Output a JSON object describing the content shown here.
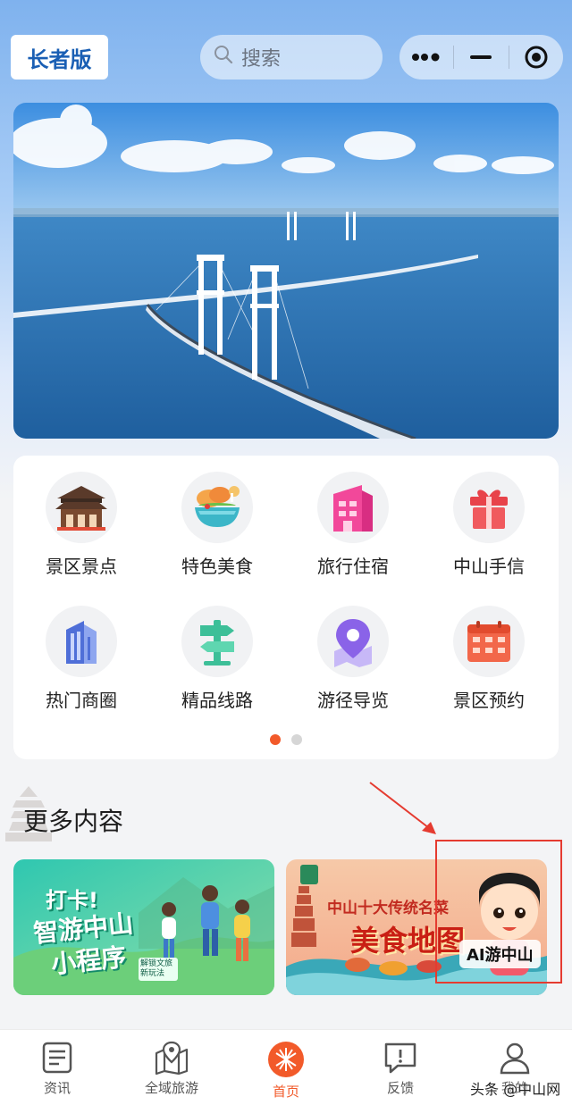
{
  "header": {
    "elder_mode": "长者版",
    "search_placeholder": "搜索"
  },
  "grid": {
    "items": [
      {
        "label": "景区景点",
        "icon": "pavilion-icon"
      },
      {
        "label": "特色美食",
        "icon": "food-bowl-icon"
      },
      {
        "label": "旅行住宿",
        "icon": "hotel-building-icon"
      },
      {
        "label": "中山手信",
        "icon": "gift-icon"
      },
      {
        "label": "热门商圈",
        "icon": "office-building-icon"
      },
      {
        "label": "精品线路",
        "icon": "signpost-icon"
      },
      {
        "label": "游径导览",
        "icon": "map-pin-icon"
      },
      {
        "label": "景区预约",
        "icon": "calendar-icon"
      }
    ],
    "page_count": 2,
    "active_page": 1
  },
  "section": {
    "title": "更多内容"
  },
  "promos": {
    "left": {
      "line1": "打卡!",
      "line2": "智游中山",
      "line3": "小程序",
      "badge": "解锁文旅新玩法"
    },
    "right": {
      "subtitle": "中山十大传统名菜",
      "title": "美食地图",
      "ai_label": "AI游中山"
    }
  },
  "tabbar": {
    "items": [
      {
        "label": "资讯",
        "icon": "news-icon"
      },
      {
        "label": "全域旅游",
        "icon": "map-location-icon"
      },
      {
        "label": "首页",
        "icon": "home-logo-icon"
      },
      {
        "label": "反馈",
        "icon": "feedback-icon"
      },
      {
        "label": "我的",
        "icon": "user-icon"
      }
    ],
    "active": "首页"
  },
  "watermark": "头条 @中山网",
  "colors": {
    "accent": "#f25a2a",
    "elder_text": "#1a5fb4",
    "annotation": "#e53b30"
  }
}
